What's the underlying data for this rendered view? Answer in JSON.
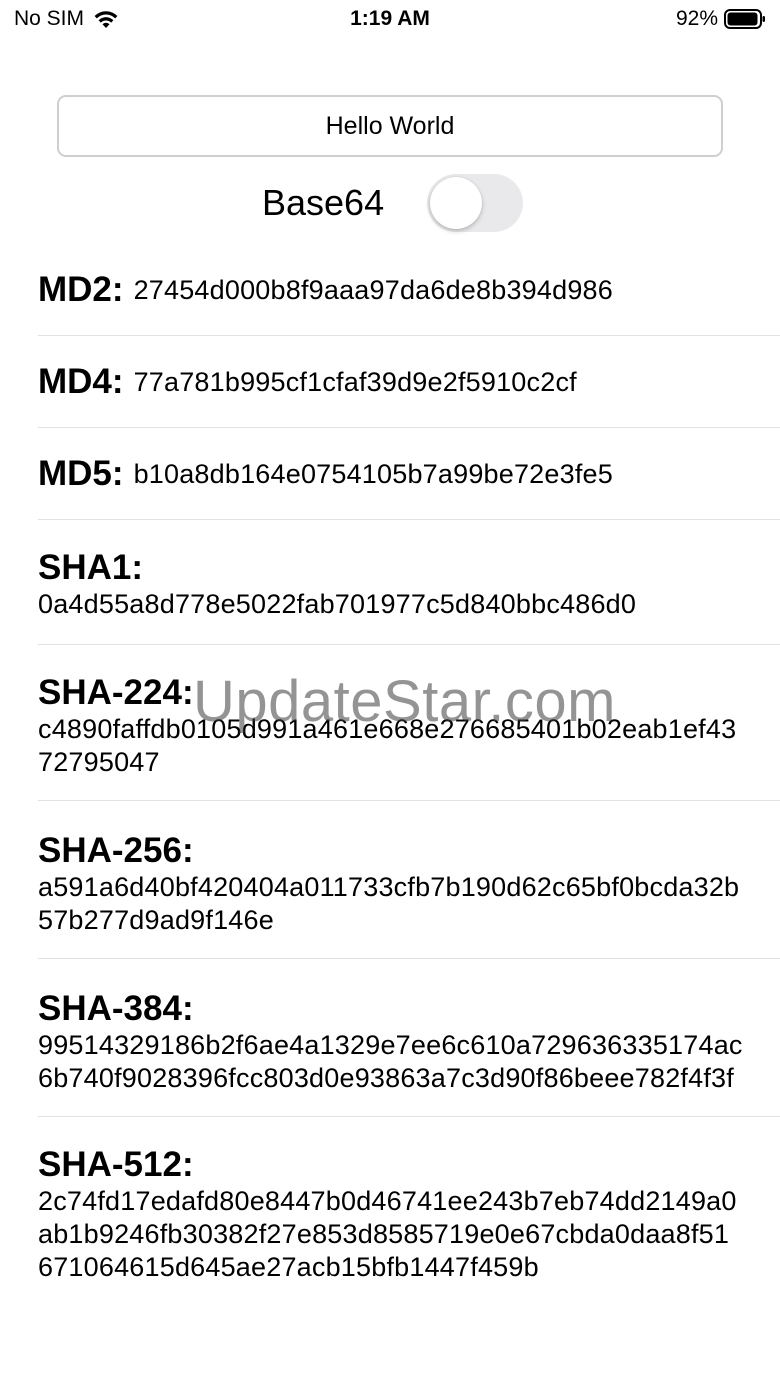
{
  "status_bar": {
    "carrier": "No SIM",
    "time": "1:19 AM",
    "battery": "92%"
  },
  "input": {
    "value": "Hello World",
    "placeholder": ""
  },
  "base64_toggle": {
    "label": "Base64",
    "on": false
  },
  "hashes": [
    {
      "label": "MD2:",
      "value": "27454d000b8f9aaa97da6de8b394d986"
    },
    {
      "label": "MD4:",
      "value": "77a781b995cf1cfaf39d9e2f5910c2cf"
    },
    {
      "label": "MD5:",
      "value": "b10a8db164e0754105b7a99be72e3fe5"
    },
    {
      "label": "SHA1:",
      "value": "0a4d55a8d778e5022fab701977c5d840bbc486d0"
    },
    {
      "label": "SHA-224:",
      "value": "c4890faffdb0105d991a461e668e276685401b02eab1ef4372795047"
    },
    {
      "label": "SHA-256:",
      "value": "a591a6d40bf420404a011733cfb7b190d62c65bf0bcda32b57b277d9ad9f146e"
    },
    {
      "label": "SHA-384:",
      "value": "99514329186b2f6ae4a1329e7ee6c610a729636335174ac6b740f9028396fcc803d0e93863a7c3d90f86beee782f4f3f"
    },
    {
      "label": "SHA-512:",
      "value": "2c74fd17edafd80e8447b0d46741ee243b7eb74dd2149a0ab1b9246fb30382f27e853d8585719e0e67cbda0daa8f51671064615d645ae27acb15bfb1447f459b"
    }
  ],
  "watermark": "UpdateStar.com",
  "colors": {
    "separator": "#e2e2e2",
    "toggle_off": "#e9e9eb",
    "input_border": "#cfcfcf"
  }
}
